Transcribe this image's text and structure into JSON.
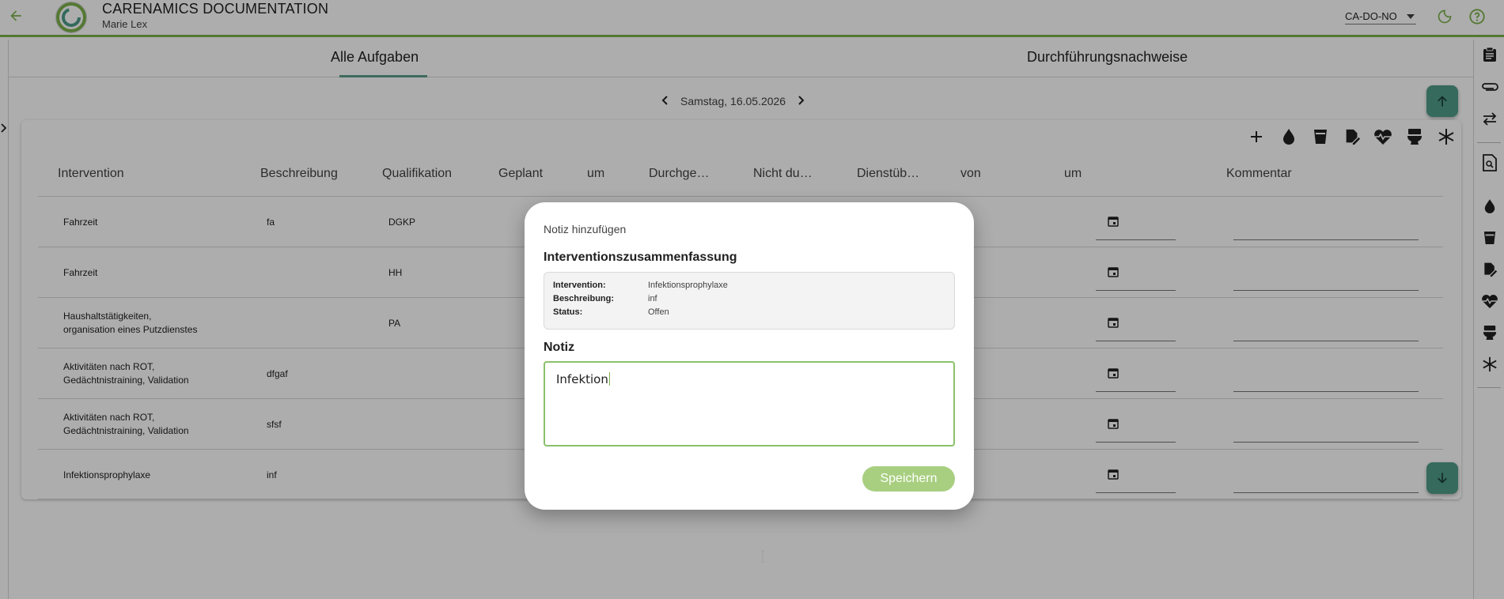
{
  "header": {
    "app_title": "CARENAMICS DOCUMENTATION",
    "user_name": "Marie Lex",
    "account": "CA-DO-NO",
    "accent_color": "#7cb24a"
  },
  "tabs": [
    {
      "label": "Alle Aufgaben",
      "active": true
    },
    {
      "label": "Durchführungsnachweise",
      "active": false
    }
  ],
  "date_nav": {
    "date": "Samstag, 16.05.2026"
  },
  "table": {
    "columns": [
      "Intervention",
      "Beschreibung",
      "Qualifikation",
      "Geplant",
      "um",
      "Durchge…",
      "Nicht du…",
      "Dienstüb…",
      "von",
      "um",
      "Kommentar"
    ],
    "rows": [
      {
        "intervention": "Fahrzeit",
        "beschreibung": "fa",
        "qualifikation": "DGKP"
      },
      {
        "intervention": "Fahrzeit",
        "beschreibung": "",
        "qualifikation": "HH"
      },
      {
        "intervention": "Haushaltstätigkeiten,\norganisation eines Putzdienstes",
        "beschreibung": "",
        "qualifikation": "PA"
      },
      {
        "intervention": "Aktivitäten nach ROT,\nGedächtnistraining, Validation",
        "beschreibung": "dfgaf",
        "qualifikation": ""
      },
      {
        "intervention": "Aktivitäten nach ROT,\nGedächtnistraining, Validation",
        "beschreibung": "sfsf",
        "qualifikation": ""
      },
      {
        "intervention": "Infektionsprophylaxe",
        "beschreibung": "inf",
        "qualifikation": ""
      }
    ]
  },
  "toolbar_icons": [
    "add-icon",
    "drop-icon",
    "cup-icon",
    "edit-note-icon",
    "heart-pulse-icon",
    "toilet-icon",
    "snowflake-icon"
  ],
  "right_toolbar_icons": [
    "clipboard-icon",
    "paperclip-icon",
    "swap-icon",
    "document-search-icon",
    "drop-icon",
    "cup-icon",
    "edit-note-icon",
    "heart-pulse-icon",
    "toilet-icon",
    "snowflake-icon"
  ],
  "dialog": {
    "title": "Notiz hinzufügen",
    "summary_heading": "Interventionszusammenfassung",
    "summary": {
      "intervention_label": "Intervention:",
      "intervention_value": "Infektionsprophylaxe",
      "beschreibung_label": "Beschreibung:",
      "beschreibung_value": "inf",
      "status_label": "Status:",
      "status_value": "Offen"
    },
    "note_heading": "Notiz",
    "note_value": "Infektion",
    "save_label": "Speichern",
    "save_color": "#a8cf80"
  }
}
